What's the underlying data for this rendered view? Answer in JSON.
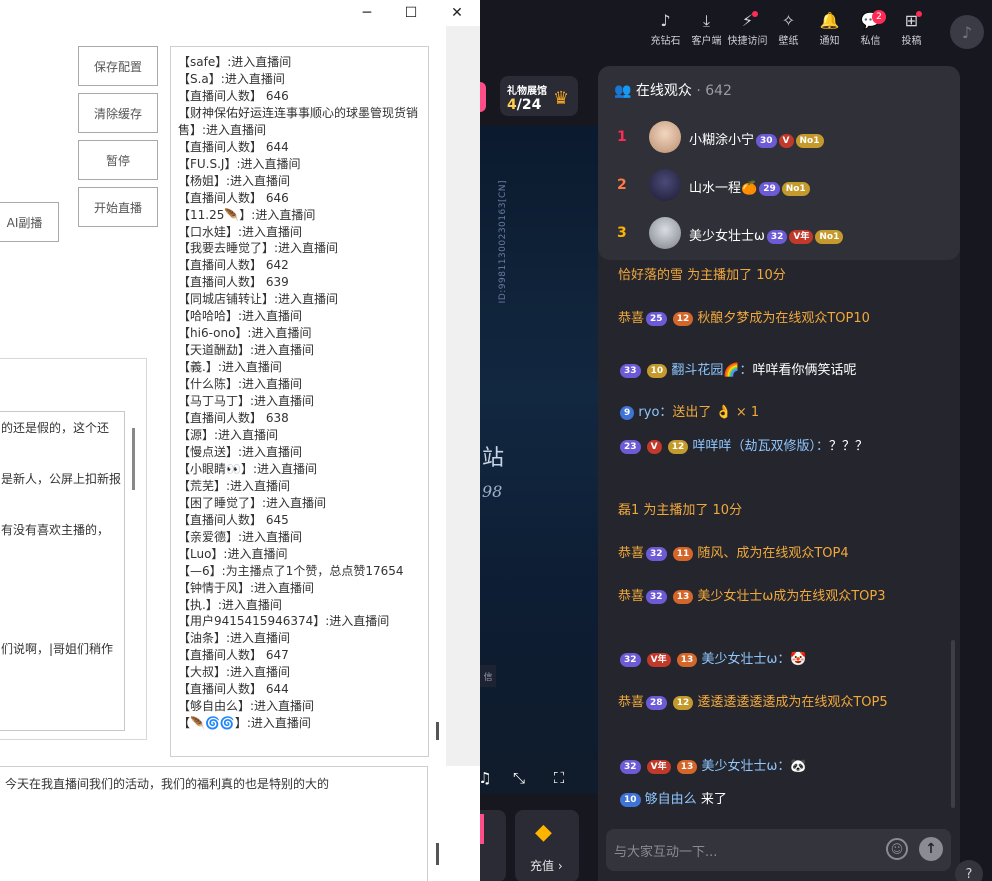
{
  "tool": {
    "window_controls": {
      "minimize": "─",
      "maximize": "☐",
      "close": "✕"
    },
    "buttons": {
      "save": "保存配置",
      "clear": "清除缓存",
      "pause": "暂停",
      "start": "开始直播",
      "ai": "AI副播"
    },
    "left_lines": [
      "的还是假的，这个还",
      "是新人，公屏上扣新报",
      "有没有喜欢主播的，",
      "们说啊，|哥姐们稍作"
    ],
    "log_lines": [
      "【safe】:进入直播间",
      "【S.a】:进入直播间",
      "【直播间人数】 646",
      "【财神保佑好运连连事事顺心的球墨管现货销售】:进入直播间",
      "【直播间人数】 644",
      "【FU.S.J】:进入直播间",
      "【杨姐】:进入直播间",
      "【直播间人数】 646",
      "【11.25🪶】:进入直播间",
      "【口水娃】:进入直播间",
      "【我要去睡觉了】:进入直播间",
      "【直播间人数】 642",
      "【直播间人数】 639",
      "【同城店铺转让】:进入直播间",
      "【哈哈哈】:进入直播间",
      "【hi6-ono】:进入直播间",
      "【天道酬勐】:进入直播间",
      "【義.】:进入直播间",
      "【什么陈】:进入直播间",
      "【马丁马丁】:进入直播间",
      "【直播间人数】 638",
      "【源】:进入直播间",
      "【慢点送】:进入直播间",
      "【小眼睛👀】:进入直播间",
      "【荒芜】:进入直播间",
      "【困了睡觉了】:进入直播间",
      "【直播间人数】 645",
      "【亲爱德】:进入直播间",
      "【Luo】:进入直播间",
      "【—6】:为主播点了1个赞，总点赞17654",
      "【钟情于风】:进入直播间",
      "【执.】:进入直播间",
      "【用户9415415946374】:进入直播间",
      "【油条】:进入直播间",
      "【直播间人数】 647",
      "【大叔】:进入直播间",
      "【直播间人数】 644",
      "【够自由么】:进入直播间",
      "【🪶🌀🌀】:进入直播间"
    ],
    "script_text": "今天在我直播间我们的活动，我们的福利真的也是特别的大的"
  },
  "topbar": {
    "items": [
      {
        "icon": "♪",
        "label": "充钻石"
      },
      {
        "icon": "⤓",
        "label": "客户端"
      },
      {
        "icon": "⚡",
        "label": "快捷访问"
      },
      {
        "icon": "✧",
        "label": "壁纸"
      },
      {
        "icon": "🔔",
        "label": "通知"
      },
      {
        "icon": "💬",
        "label": "私信"
      },
      {
        "icon": "⊞",
        "label": "投稿"
      }
    ],
    "message_badge": "2"
  },
  "stream": {
    "gift_title": "礼物展馆",
    "gift_current": "4",
    "gift_total": "/24",
    "video_id": "ID:99811300230163[CN]",
    "video_glyph_a": "站",
    "video_glyph_b": "98",
    "video_tag": "信",
    "recharge_label": "充值 ›"
  },
  "viewers": {
    "title": "在线观众",
    "count": "· 642",
    "list": [
      {
        "rank": "1",
        "name": "小糊涂小宁",
        "level": "30",
        "color": "#fe2c55"
      },
      {
        "rank": "2",
        "name": "山水一程🍊",
        "level": "29",
        "color": "#ff7a45"
      },
      {
        "rank": "3",
        "name": "美少女壮士ω",
        "level": "32",
        "color": "#ffb400"
      }
    ],
    "no1_label": "No1",
    "v_label": "V",
    "v_year_label": "V年"
  },
  "chat": {
    "messages": [
      {
        "text": "恰好落的雪 为主播加了 10分"
      },
      {
        "prefix": "恭喜",
        "level": "25",
        "fan": "12",
        "text": "秋酿夕梦成为在线观众TOP10"
      },
      {
        "level": "33",
        "fan": "10",
        "user": "翻斗花园🌈：",
        "text": "咩咩看你俩笑话呢"
      },
      {
        "level": "9",
        "user": "ryo：",
        "text": "送出了 👌 × 1"
      },
      {
        "level": "23",
        "fan": "12",
        "user": "咩咩咩（劫瓦双修版）：",
        "text": "？？？"
      },
      {
        "text": "磊1 为主播加了 10分"
      },
      {
        "prefix": "恭喜",
        "level": "32",
        "fan": "11",
        "text": "随风、成为在线观众TOP4"
      },
      {
        "prefix": "恭喜",
        "level": "32",
        "fan": "13",
        "text": "美少女壮士ω成为在线观众TOP3"
      },
      {
        "level": "32",
        "fan": "13",
        "user": "美少女壮士ω：",
        "text": "🤡"
      },
      {
        "prefix": "恭喜",
        "level": "28",
        "fan": "12",
        "text": "逶逶逶逶逶逶成为在线观众TOP5"
      },
      {
        "level": "32",
        "fan": "13",
        "user": "美少女壮士ω：",
        "text": "🐼"
      },
      {
        "level": "10",
        "user": "够自由么",
        "text": "来了"
      }
    ],
    "input_placeholder": "与大家互动一下..."
  }
}
